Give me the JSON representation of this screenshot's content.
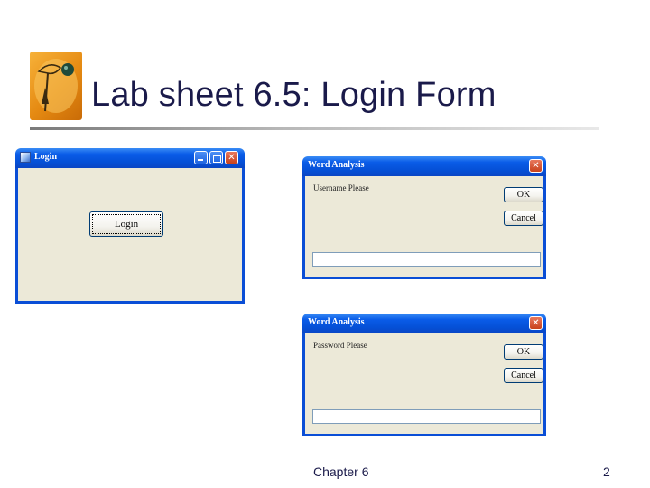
{
  "slide": {
    "title": "Lab sheet 6.5: Login Form",
    "footer_chapter": "Chapter 6",
    "page_number": "2"
  },
  "login_window": {
    "title": "Login",
    "button_label": "Login"
  },
  "dialog_username": {
    "title": "Word Analysis",
    "prompt": "Username Please",
    "ok_label": "OK",
    "cancel_label": "Cancel",
    "input_value": ""
  },
  "dialog_password": {
    "title": "Word Analysis",
    "prompt": "Password Please",
    "ok_label": "OK",
    "cancel_label": "Cancel",
    "input_value": ""
  },
  "colors": {
    "title_text": "#1a1a4a",
    "xp_titlebar": "#0a5ce8",
    "window_face": "#ece9d8",
    "close_button": "#c8421c"
  },
  "icons": [
    "logo-icon",
    "app-icon",
    "minimize-icon",
    "maximize-icon",
    "close-icon"
  ]
}
